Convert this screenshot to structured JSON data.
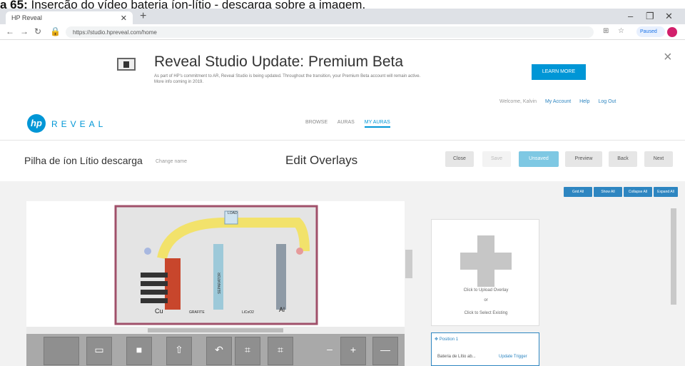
{
  "caption": {
    "prefix": "a 65:",
    "text": " Inserção do vídeo bateria íon-lítio - descarga sobre a imagem."
  },
  "browser": {
    "tab_title": "HP Reveal",
    "url": "https://studio.hpreveal.com/home",
    "paused_label": "Paused"
  },
  "banner": {
    "title": "Reveal Studio Update: Premium Beta",
    "body": "As part of HP's commitment to AR, Reveal Studio is being updated. Throughout the transition, your Premium Beta account will remain active. More info coming in 2019.",
    "cta": "LEARN MORE",
    "close": "×"
  },
  "user_links": [
    "Welcome, Kalvin",
    "My Account",
    "Help",
    "Log Out"
  ],
  "brand": {
    "logo": "hp",
    "name": "REVEAL"
  },
  "nav": {
    "items": [
      "BROWSE",
      "AURAS",
      "MY AURAS"
    ]
  },
  "titlebar": {
    "project_name": "Pilha de íon Lítio descarga",
    "change_label": "Change name",
    "mode": "Edit Overlays",
    "buttons": [
      "Close",
      "Save",
      "Unsaved",
      "Preview",
      "Back",
      "Next"
    ]
  },
  "tools": [
    "Grid All",
    "Show All",
    "Collapse All",
    "Expand All"
  ],
  "diagram": {
    "labels": {
      "cu": "Cu",
      "al": "Al",
      "separator": "SEPARATOR",
      "grafite": "GRAFITE",
      "licoo2": "LiCoO2",
      "load": "LOAD"
    }
  },
  "overlay_panel": {
    "line1": "Click to Upload Overlay",
    "line2": "or",
    "line3": "Click to Select Existing"
  },
  "poi": {
    "header": "Position 1",
    "row_name": "Bateria de Lítio ab...",
    "row_action": "Update Trigger"
  },
  "colors": {
    "accent": "#0096d6",
    "button_blue": "#2e86c1"
  }
}
